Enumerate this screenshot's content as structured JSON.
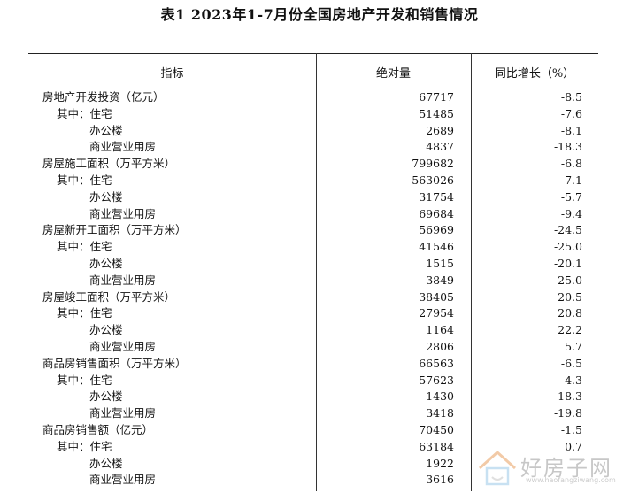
{
  "title": "表1    2023年1-7月份全国房地产开发和销售情况",
  "columns": {
    "indicator": "指标",
    "absolute": "绝对量",
    "yoy": "同比增长（%）"
  },
  "rows": [
    {
      "prefix": "",
      "label": "房地产开发投资（亿元）",
      "abs": "67717",
      "yoy": "-8.5",
      "indent": 0
    },
    {
      "prefix": "其中：",
      "label": "住宅",
      "abs": "51485",
      "yoy": "-7.6",
      "indent": 1
    },
    {
      "prefix": "",
      "label": "办公楼",
      "abs": "2689",
      "yoy": "-8.1",
      "indent": 2
    },
    {
      "prefix": "",
      "label": "商业营业用房",
      "abs": "4837",
      "yoy": "-18.3",
      "indent": 2
    },
    {
      "prefix": "",
      "label": "房屋施工面积（万平方米）",
      "abs": "799682",
      "yoy": "-6.8",
      "indent": 0
    },
    {
      "prefix": "其中：",
      "label": "住宅",
      "abs": "563026",
      "yoy": "-7.1",
      "indent": 1
    },
    {
      "prefix": "",
      "label": "办公楼",
      "abs": "31754",
      "yoy": "-5.7",
      "indent": 2
    },
    {
      "prefix": "",
      "label": "商业营业用房",
      "abs": "69684",
      "yoy": "-9.4",
      "indent": 2
    },
    {
      "prefix": "",
      "label": "房屋新开工面积（万平方米）",
      "abs": "56969",
      "yoy": "-24.5",
      "indent": 0
    },
    {
      "prefix": "其中：",
      "label": "住宅",
      "abs": "41546",
      "yoy": "-25.0",
      "indent": 1
    },
    {
      "prefix": "",
      "label": "办公楼",
      "abs": "1515",
      "yoy": "-20.1",
      "indent": 2
    },
    {
      "prefix": "",
      "label": "商业营业用房",
      "abs": "3849",
      "yoy": "-25.0",
      "indent": 2
    },
    {
      "prefix": "",
      "label": "房屋竣工面积（万平方米）",
      "abs": "38405",
      "yoy": "20.5",
      "indent": 0
    },
    {
      "prefix": "其中：",
      "label": "住宅",
      "abs": "27954",
      "yoy": "20.8",
      "indent": 1
    },
    {
      "prefix": "",
      "label": "办公楼",
      "abs": "1164",
      "yoy": "22.2",
      "indent": 2
    },
    {
      "prefix": "",
      "label": "商业营业用房",
      "abs": "2806",
      "yoy": "5.7",
      "indent": 2
    },
    {
      "prefix": "",
      "label": "商品房销售面积（万平方米）",
      "abs": "66563",
      "yoy": "-6.5",
      "indent": 0
    },
    {
      "prefix": "其中：",
      "label": "住宅",
      "abs": "57623",
      "yoy": "-4.3",
      "indent": 1
    },
    {
      "prefix": "",
      "label": "办公楼",
      "abs": "1430",
      "yoy": "-18.3",
      "indent": 2
    },
    {
      "prefix": "",
      "label": "商业营业用房",
      "abs": "3418",
      "yoy": "-19.8",
      "indent": 2
    },
    {
      "prefix": "",
      "label": "商品房销售额（亿元）",
      "abs": "70450",
      "yoy": "-1.5",
      "indent": 0
    },
    {
      "prefix": "其中：",
      "label": "住宅",
      "abs": "63184",
      "yoy": "0.7",
      "indent": 1
    },
    {
      "prefix": "",
      "label": "办公楼",
      "abs": "1922",
      "yoy": "",
      "indent": 2
    },
    {
      "prefix": "",
      "label": "商业营业用房",
      "abs": "3616",
      "yoy": "",
      "indent": 2
    }
  ],
  "watermark": {
    "text": "好房子网",
    "url": "www.haofangziwang.com"
  }
}
